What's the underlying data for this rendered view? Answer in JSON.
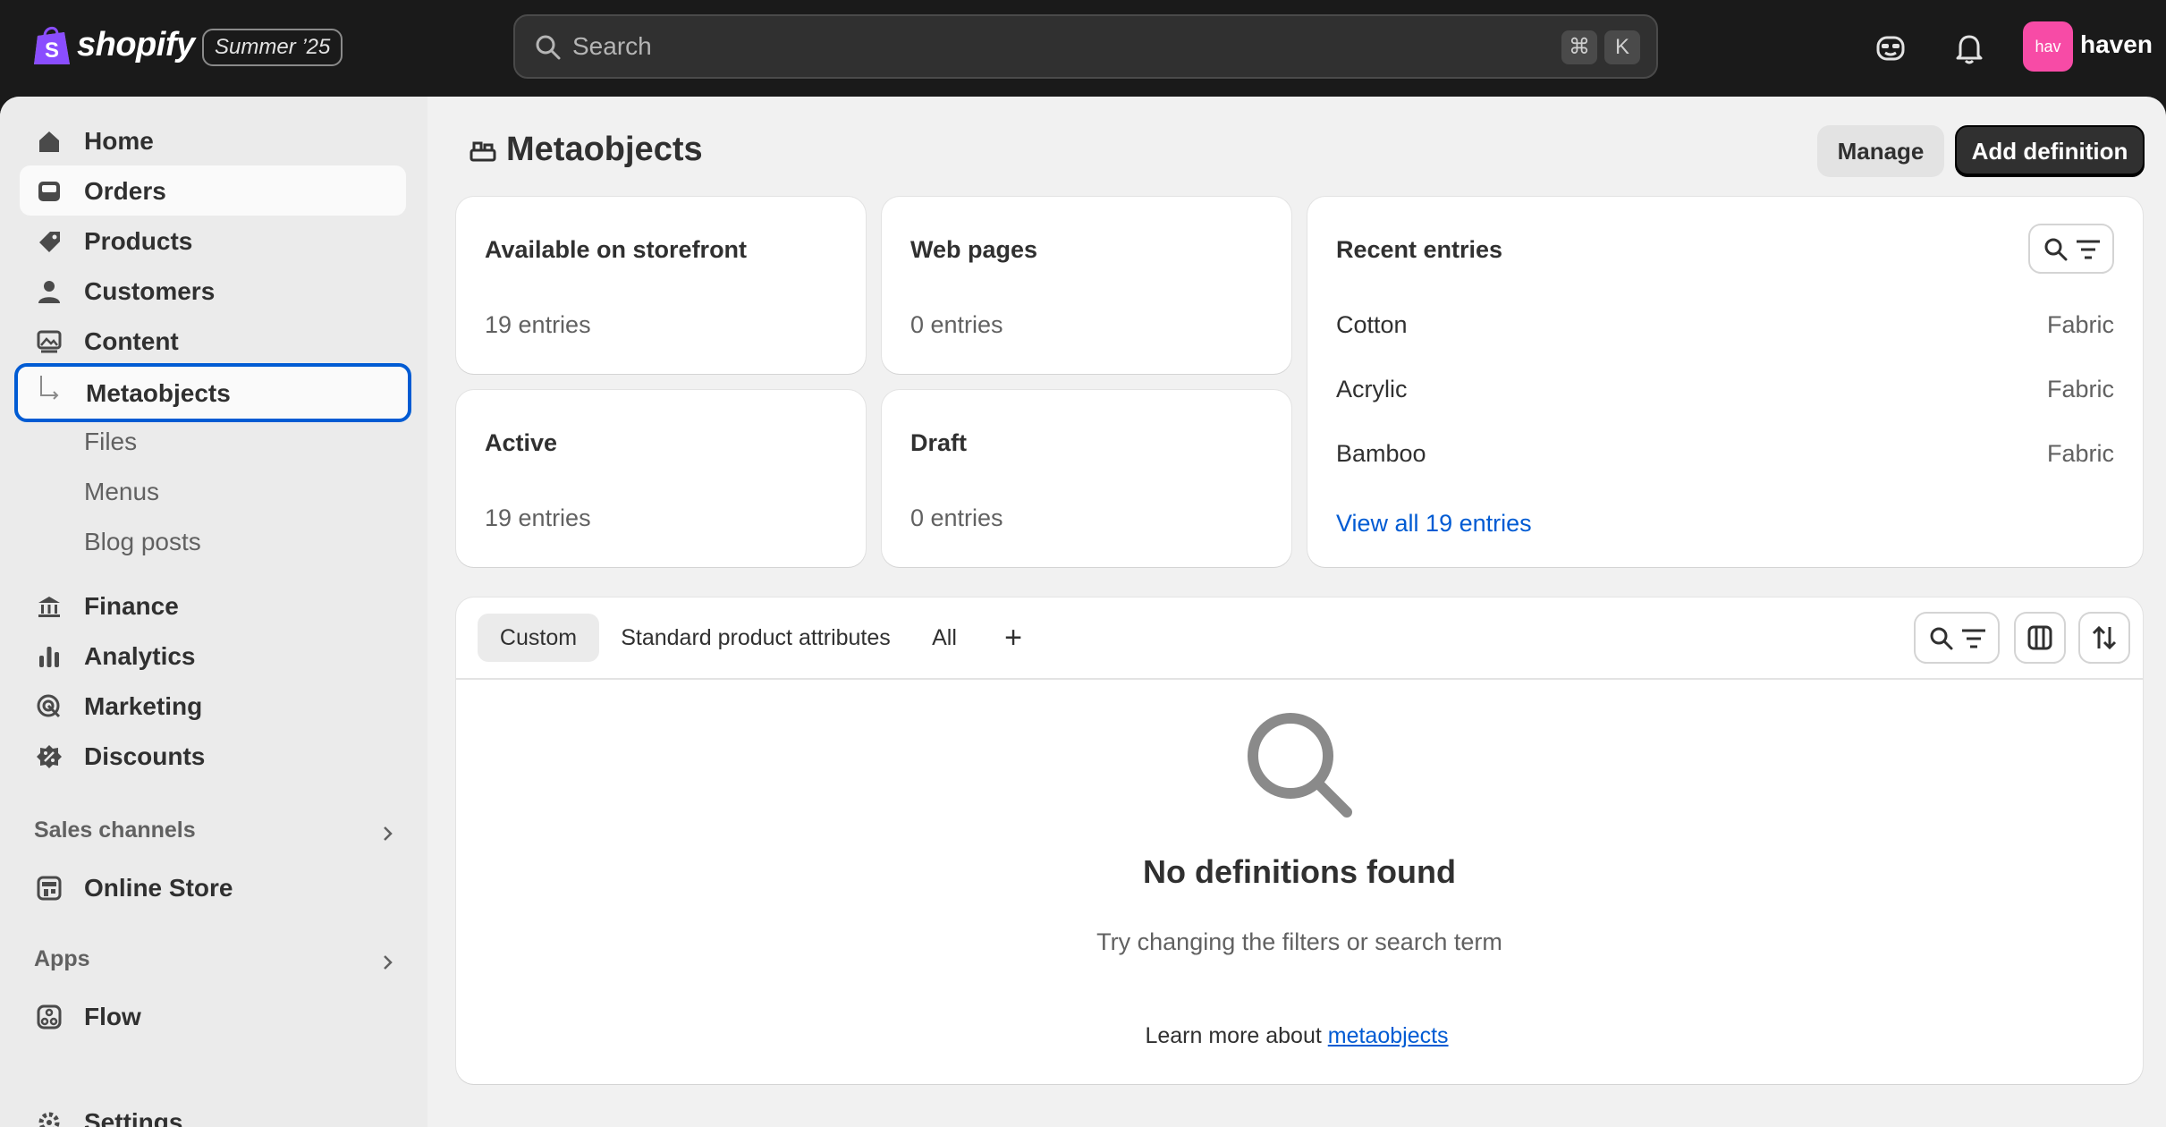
{
  "topbar": {
    "brand": "shopify",
    "edition": "Summer ’25",
    "search_placeholder": "Search",
    "shortcut_keys": [
      "⌘",
      "K"
    ],
    "user_initials": "hav",
    "user_name": "haven",
    "avatar_color": "#f74ba6"
  },
  "sidebar": {
    "items": [
      {
        "label": "Home",
        "icon": "home-icon"
      },
      {
        "label": "Orders",
        "icon": "inbox-icon"
      },
      {
        "label": "Products",
        "icon": "tag-icon"
      },
      {
        "label": "Customers",
        "icon": "person-icon"
      },
      {
        "label": "Content",
        "icon": "image-icon"
      },
      {
        "label": "Metaobjects",
        "icon": "sub-arrow-icon"
      },
      {
        "label": "Files"
      },
      {
        "label": "Menus"
      },
      {
        "label": "Blog posts"
      },
      {
        "label": "Finance",
        "icon": "bank-icon"
      },
      {
        "label": "Analytics",
        "icon": "bar-chart-icon"
      },
      {
        "label": "Marketing",
        "icon": "target-icon"
      },
      {
        "label": "Discounts",
        "icon": "discount-icon"
      },
      {
        "label": "Online Store",
        "icon": "store-icon"
      },
      {
        "label": "Flow",
        "icon": "flow-icon"
      },
      {
        "label": "Settings",
        "icon": "gear-icon"
      }
    ],
    "sales_channels": "Sales channels",
    "apps": "Apps"
  },
  "page": {
    "title": "Metaobjects",
    "manage_label": "Manage",
    "add_label": "Add definition"
  },
  "stats": [
    {
      "title": "Available on storefront",
      "value": "19 entries"
    },
    {
      "title": "Web pages",
      "value": "0 entries"
    },
    {
      "title": "Active",
      "value": "19 entries"
    },
    {
      "title": "Draft",
      "value": "0 entries"
    }
  ],
  "recent": {
    "title": "Recent entries",
    "entries": [
      {
        "name": "Cotton",
        "type": "Fabric"
      },
      {
        "name": "Acrylic",
        "type": "Fabric"
      },
      {
        "name": "Bamboo",
        "type": "Fabric"
      }
    ],
    "view_all": "View all 19 entries"
  },
  "tabs": [
    {
      "label": "Custom"
    },
    {
      "label": "Standard product attributes"
    },
    {
      "label": "All"
    }
  ],
  "add_tab_symbol": "+",
  "empty": {
    "title": "No definitions found",
    "subtitle": "Try changing the filters or search term"
  },
  "footer": {
    "prefix": "Learn more about ",
    "link": "metaobjects"
  }
}
